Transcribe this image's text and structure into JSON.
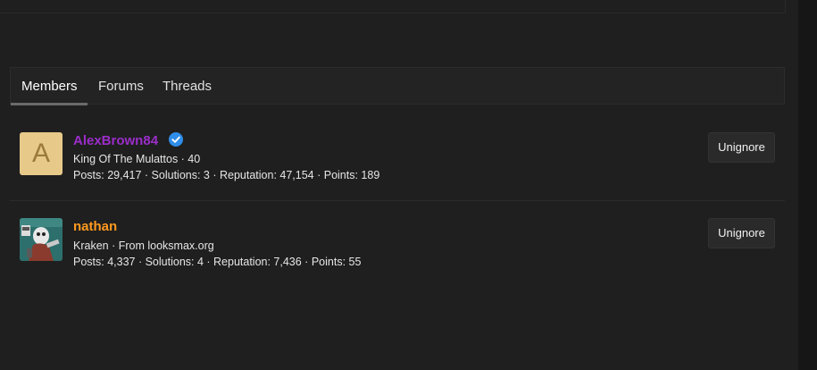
{
  "tabs": [
    {
      "label": "Members",
      "active": true
    },
    {
      "label": "Forums",
      "active": false
    },
    {
      "label": "Threads",
      "active": false
    }
  ],
  "members": [
    {
      "avatar_letter": "A",
      "username": "AlexBrown84",
      "verified": true,
      "title_line": "King Of The Mulattos · 40",
      "stats_line": "Posts: 29,417 · Solutions: 3 · Reputation: 47,154 · Points: 189",
      "action_label": "Unignore"
    },
    {
      "username": "nathan",
      "verified": false,
      "title_line": "Kraken · From looksmax.org",
      "stats_line": "Posts: 4,337 · Solutions: 4 · Reputation: 7,436 · Points: 55",
      "action_label": "Unignore"
    }
  ],
  "colors": {
    "username_purple": "#9b2dc9",
    "username_orange": "#ff9a1f",
    "verified_blue": "#2f8dea",
    "background": "#1f1f1f"
  }
}
